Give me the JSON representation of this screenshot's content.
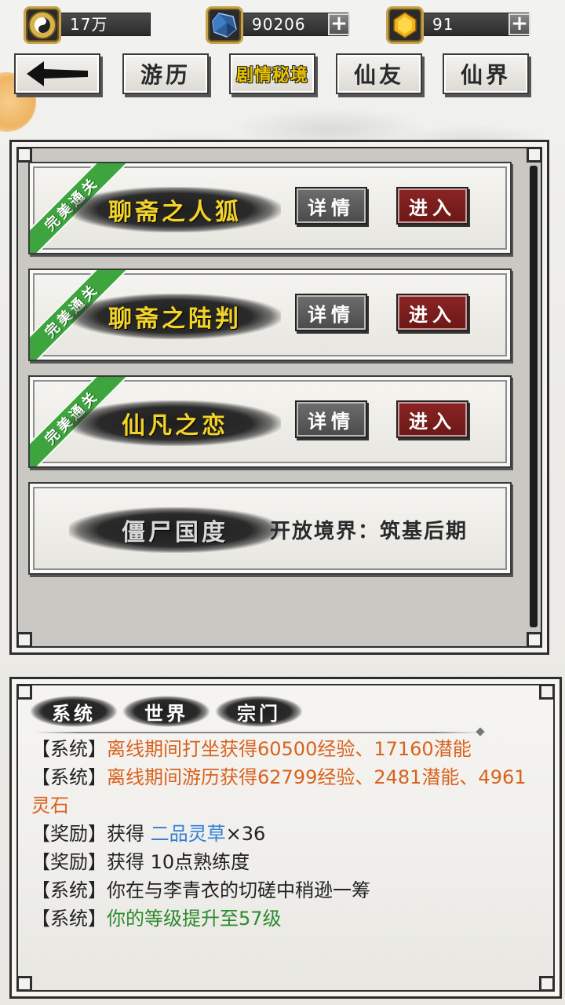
{
  "resources": {
    "silver": {
      "value": "17万",
      "icon": "yin-yang-coin-icon"
    },
    "crystal": {
      "value": "90206",
      "icon": "blue-crystal-icon"
    },
    "gold": {
      "value": "91",
      "icon": "gold-gem-icon"
    }
  },
  "nav": {
    "back": "←",
    "tabs": [
      "游历",
      "剧情秘境",
      "仙友",
      "仙界"
    ],
    "active": "剧情秘境"
  },
  "dungeons": [
    {
      "badge": "完美通关",
      "title": "聊斋之人狐",
      "detail": "详情",
      "enter": "进入"
    },
    {
      "badge": "完美通关",
      "title": "聊斋之陆判",
      "detail": "详情",
      "enter": "进入"
    },
    {
      "badge": "完美通关",
      "title": "仙凡之恋",
      "detail": "详情",
      "enter": "进入"
    },
    {
      "title": "僵尸国度",
      "requirement": "开放境界：筑基后期"
    }
  ],
  "chat": {
    "tabs": [
      "系统",
      "世界",
      "宗门"
    ],
    "lines": [
      {
        "tag": "【系统】",
        "text": "离线期间打坐获得60500经验、17160潜能",
        "color": "orange"
      },
      {
        "tag": "【系统】",
        "text": "离线期间游历获得62799经验、2481潜能、4961灵石",
        "color": "orange"
      },
      {
        "tag": "【奖励】",
        "text_pre": "获得 ",
        "item": "二品灵草",
        "text_post": "×36"
      },
      {
        "tag": "【奖励】",
        "text": "获得 10点熟练度",
        "color": "plain"
      },
      {
        "tag": "【系统】",
        "text": "你在与李青衣的切磋中稍逊一筹",
        "color": "plain"
      },
      {
        "tag": "【系统】",
        "text": "你的等级提升至57级",
        "color": "green"
      }
    ]
  },
  "colors": {
    "accent_gold": "#f2d32a",
    "ribbon_green": "#3ea53e",
    "enter_red": "#7a1e1e",
    "log_orange": "#d9621e",
    "log_blue": "#2e7fd6",
    "log_green": "#2d8a2d"
  }
}
